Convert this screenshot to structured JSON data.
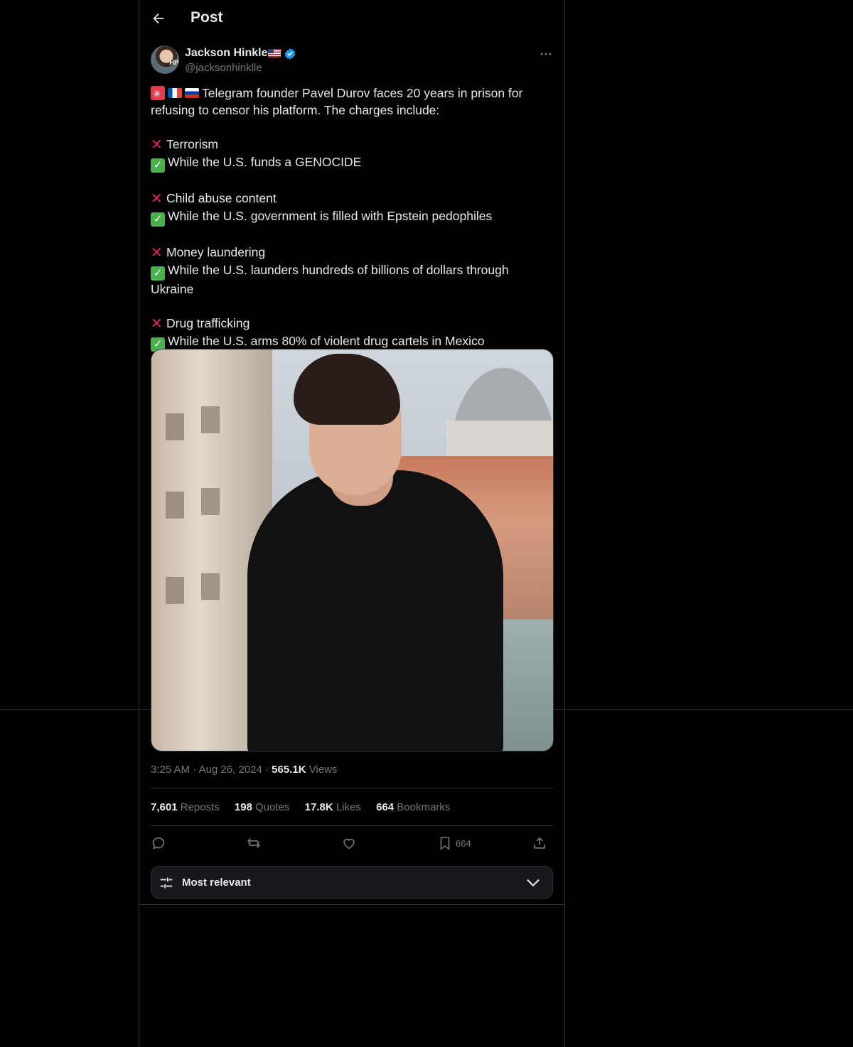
{
  "header": {
    "title": "Post"
  },
  "author": {
    "name": "Jackson Hinkle",
    "handle": "@jacksonhinklle",
    "avatar_tag": "HP"
  },
  "tweet": {
    "intro": "Telegram founder Pavel Durov faces 20 years in prison for refusing to censor his platform. The charges include:",
    "pairs": [
      {
        "x": "Terrorism",
        "check": "While the U.S. funds a GENOCIDE"
      },
      {
        "x": "Child abuse content",
        "check": "While the U.S. government is filled with Epstein pedophiles"
      },
      {
        "x": "Money laundering",
        "check": "While the U.S. launders hundreds of billions of dollars through Ukraine"
      },
      {
        "x": "Drug trafficking",
        "check": "While the U.S. arms 80% of violent drug cartels in Mexico"
      }
    ]
  },
  "meta": {
    "time": "3:25 AM",
    "date": "Aug 26, 2024",
    "views_count": "565.1K",
    "views_label": "Views"
  },
  "stats": {
    "reposts": {
      "count": "7,601",
      "label": "Reposts"
    },
    "quotes": {
      "count": "198",
      "label": "Quotes"
    },
    "likes": {
      "count": "17.8K",
      "label": "Likes"
    },
    "bookmarks": {
      "count": "664",
      "label": "Bookmarks"
    }
  },
  "actions": {
    "bookmark_count": "664"
  },
  "sort": {
    "label": "Most relevant"
  },
  "colors": {
    "accent": "#1d9bf0",
    "background": "#000000",
    "text": "#e7e9ea",
    "muted": "#71767b",
    "border": "#2f3336"
  }
}
